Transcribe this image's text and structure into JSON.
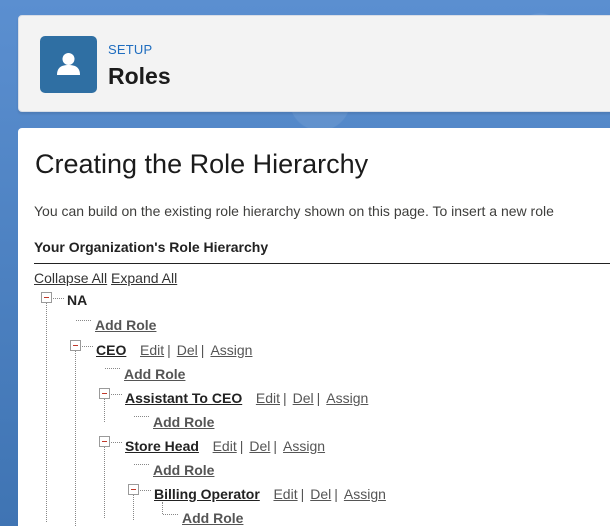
{
  "header": {
    "setup_label": "SETUP",
    "title": "Roles",
    "icon": "user-icon"
  },
  "content": {
    "title": "Creating the Role Hierarchy",
    "intro": "You can build on the existing role hierarchy shown on this page. To insert a new role",
    "section_heading": "Your Organization's Role Hierarchy",
    "collapse_all": "Collapse All",
    "expand_all": "Expand All"
  },
  "tree": {
    "root": "NA",
    "add_role": "Add Role",
    "actions": {
      "edit": "Edit",
      "del": "Del",
      "assign": "Assign",
      "separator": "|"
    },
    "roles": [
      "CEO",
      "Assistant To CEO",
      "Store Head",
      "Billing Operator"
    ]
  },
  "colors": {
    "background": "#3f74b3",
    "icon_bg": "#2f6fa3",
    "setup_label": "#1f6dbf",
    "toggle_minus": "#c0392b"
  }
}
